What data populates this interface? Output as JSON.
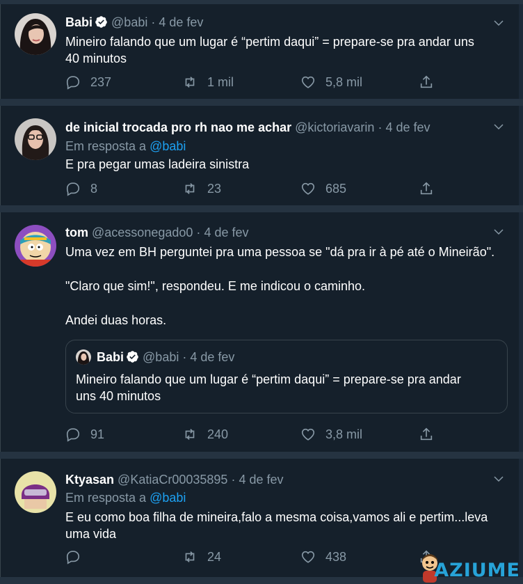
{
  "colors": {
    "background": "#15202b",
    "separator": "#253341",
    "text_primary": "#ffffff",
    "text_secondary": "#8899a6",
    "link": "#1da1f2",
    "verified": "#ffffff",
    "watermark": "#27a3d8"
  },
  "icons": {
    "reply": "speech-bubble-icon",
    "retweet": "retweet-arrows-icon",
    "like": "heart-icon",
    "share": "upload-share-icon",
    "more": "chevron-down-icon",
    "verified": "verified-badge-icon"
  },
  "tweets": [
    {
      "name": "Babi",
      "verified": true,
      "handle": "@babi",
      "date": "4 de fev",
      "text": [
        "Mineiro falando que um lugar é “pertim daqui” = prepare-se pra andar uns",
        "40 minutos"
      ],
      "replies": "237",
      "retweets": "1 mil",
      "likes": "5,8 mil"
    },
    {
      "name": "de inicial trocada pro rh nao me achar",
      "handle": "@kictoriavarin",
      "date": "4 de fev",
      "reply_prefix": "Em resposta a",
      "reply_to": "@babi",
      "text": [
        "E pra pegar umas ladeira sinistra"
      ],
      "replies": "8",
      "retweets": "23",
      "likes": "685"
    },
    {
      "name": "tom",
      "handle": "@acessonegado0",
      "date": "4 de fev",
      "text": [
        "Uma vez em BH perguntei pra uma pessoa se \"dá pra ir à pé até o Mineirão\".",
        "\"Claro que sim!\", respondeu. E me indicou o caminho.",
        "Andei duas horas."
      ],
      "quote": {
        "name": "Babi",
        "verified": true,
        "handle": "@babi",
        "date": "4 de fev",
        "text": [
          "Mineiro falando que um lugar é “pertim daqui” = prepare-se pra andar",
          "uns 40 minutos"
        ]
      },
      "replies": "91",
      "retweets": "240",
      "likes": "3,8 mil"
    },
    {
      "name": "Ktyasan",
      "handle": "@KatiaCr00035895",
      "date": "4 de fev",
      "reply_prefix": "Em resposta a",
      "reply_to": "@babi",
      "text": [
        "E eu como boa filha de mineira,falo a mesma coisa,vamos ali e pertim...leva",
        "uma vida"
      ],
      "retweets": "24",
      "likes": "438"
    }
  ],
  "watermark": {
    "text": "AZIUME"
  },
  "separator_dot": "·"
}
